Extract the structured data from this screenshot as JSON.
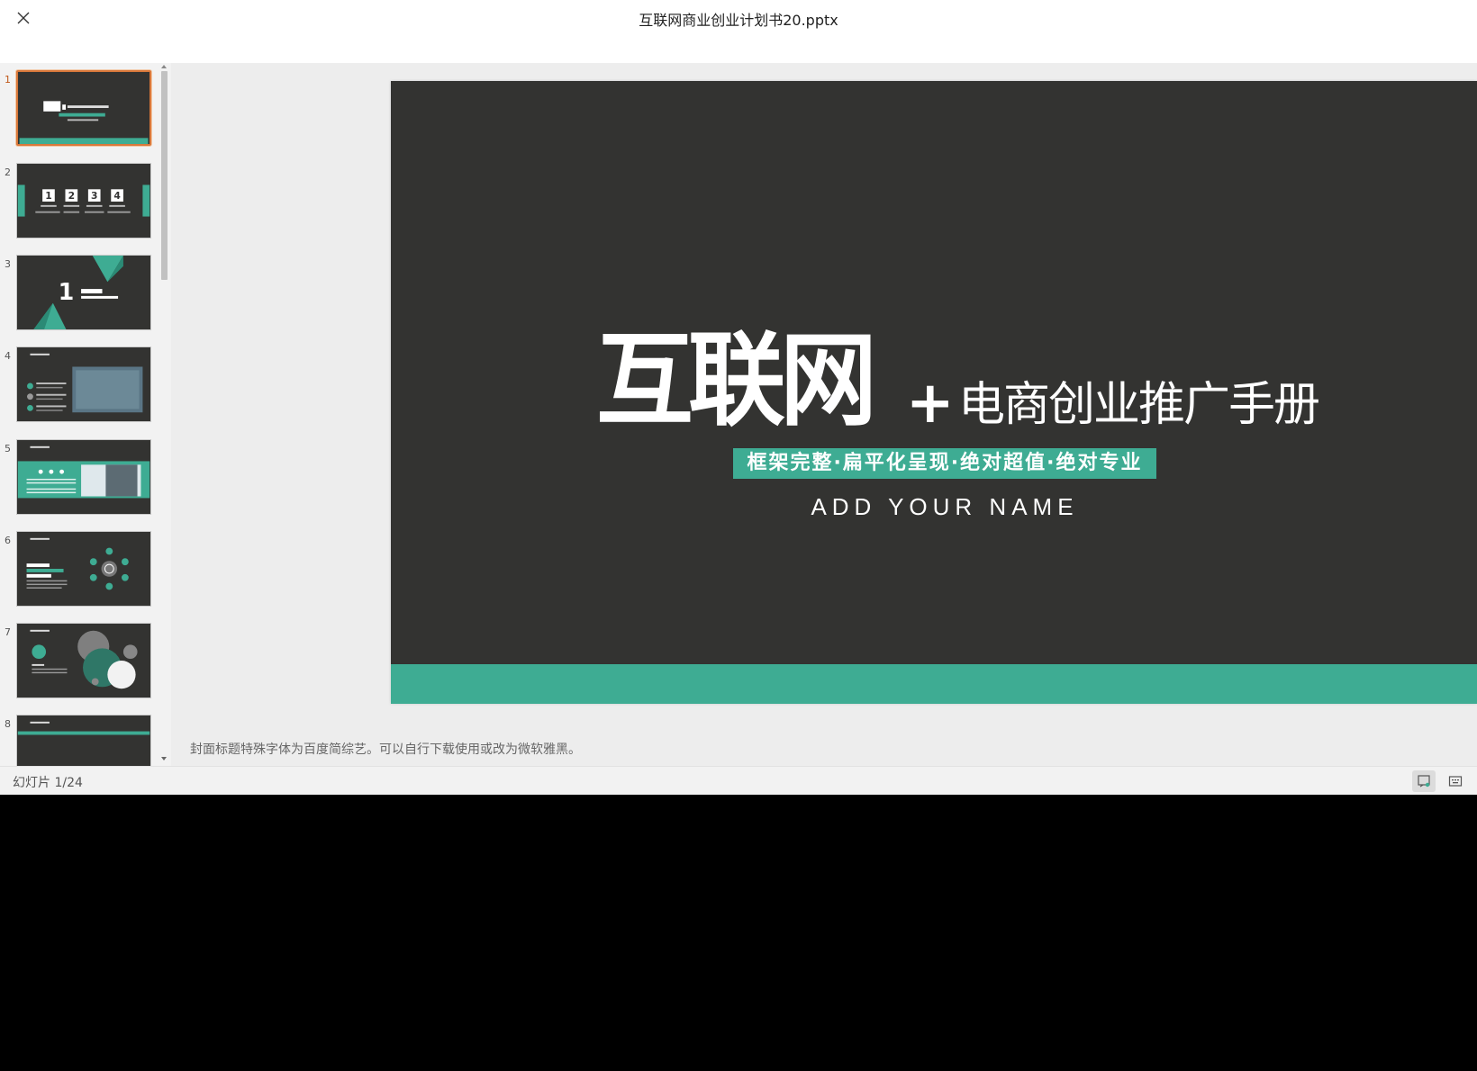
{
  "window": {
    "title": "互联网商业创业计划书20.pptx",
    "close_icon": "close-icon"
  },
  "sidebar": {
    "thumbnails": [
      {
        "number": "1",
        "active": true
      },
      {
        "number": "2",
        "active": false
      },
      {
        "number": "3",
        "active": false
      },
      {
        "number": "4",
        "active": false
      },
      {
        "number": "5",
        "active": false
      },
      {
        "number": "6",
        "active": false
      },
      {
        "number": "7",
        "active": false
      },
      {
        "number": "8",
        "active": false
      }
    ]
  },
  "slide": {
    "title_main": "互联网",
    "title_plus": "+",
    "title_rest": "电商创业推广手册",
    "tagline": "框架完整·扁平化呈现·绝对超值·绝对专业",
    "name": "ADD YOUR NAME",
    "colors": {
      "background": "#333331",
      "accent": "#3eac93"
    }
  },
  "notes": "封面标题特殊字体为百度简综艺。可以自行下载使用或改为微软雅黑。",
  "status": {
    "counter": "幻灯片 1/24"
  }
}
